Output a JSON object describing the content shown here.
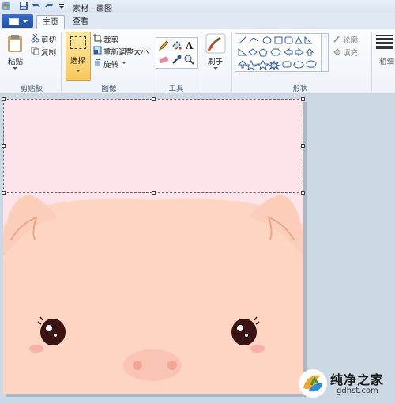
{
  "app": {
    "title": "素材 - 画图"
  },
  "tabs": {
    "home": "主页",
    "view": "查看"
  },
  "clipboard": {
    "paste": "粘贴",
    "cut": "剪切",
    "copy": "复制",
    "group": "剪贴板"
  },
  "image": {
    "select": "选择",
    "crop": "裁剪",
    "resize": "重新调整大小",
    "rotate": "旋转",
    "group": "图像"
  },
  "tools": {
    "group": "工具"
  },
  "brushes": {
    "label": "刷子"
  },
  "shapes": {
    "outline": "轮廓",
    "fill": "填充",
    "group": "形状"
  },
  "size": {
    "label": "粗细"
  },
  "watermark": {
    "title": "纯净之家",
    "url": "gdhst.com"
  },
  "colors": {
    "accent": "#1f4fa5",
    "canvas_bg": "#fde4ea",
    "pig_skin": "#fdd5c0",
    "select_active": "#fbd77e"
  }
}
